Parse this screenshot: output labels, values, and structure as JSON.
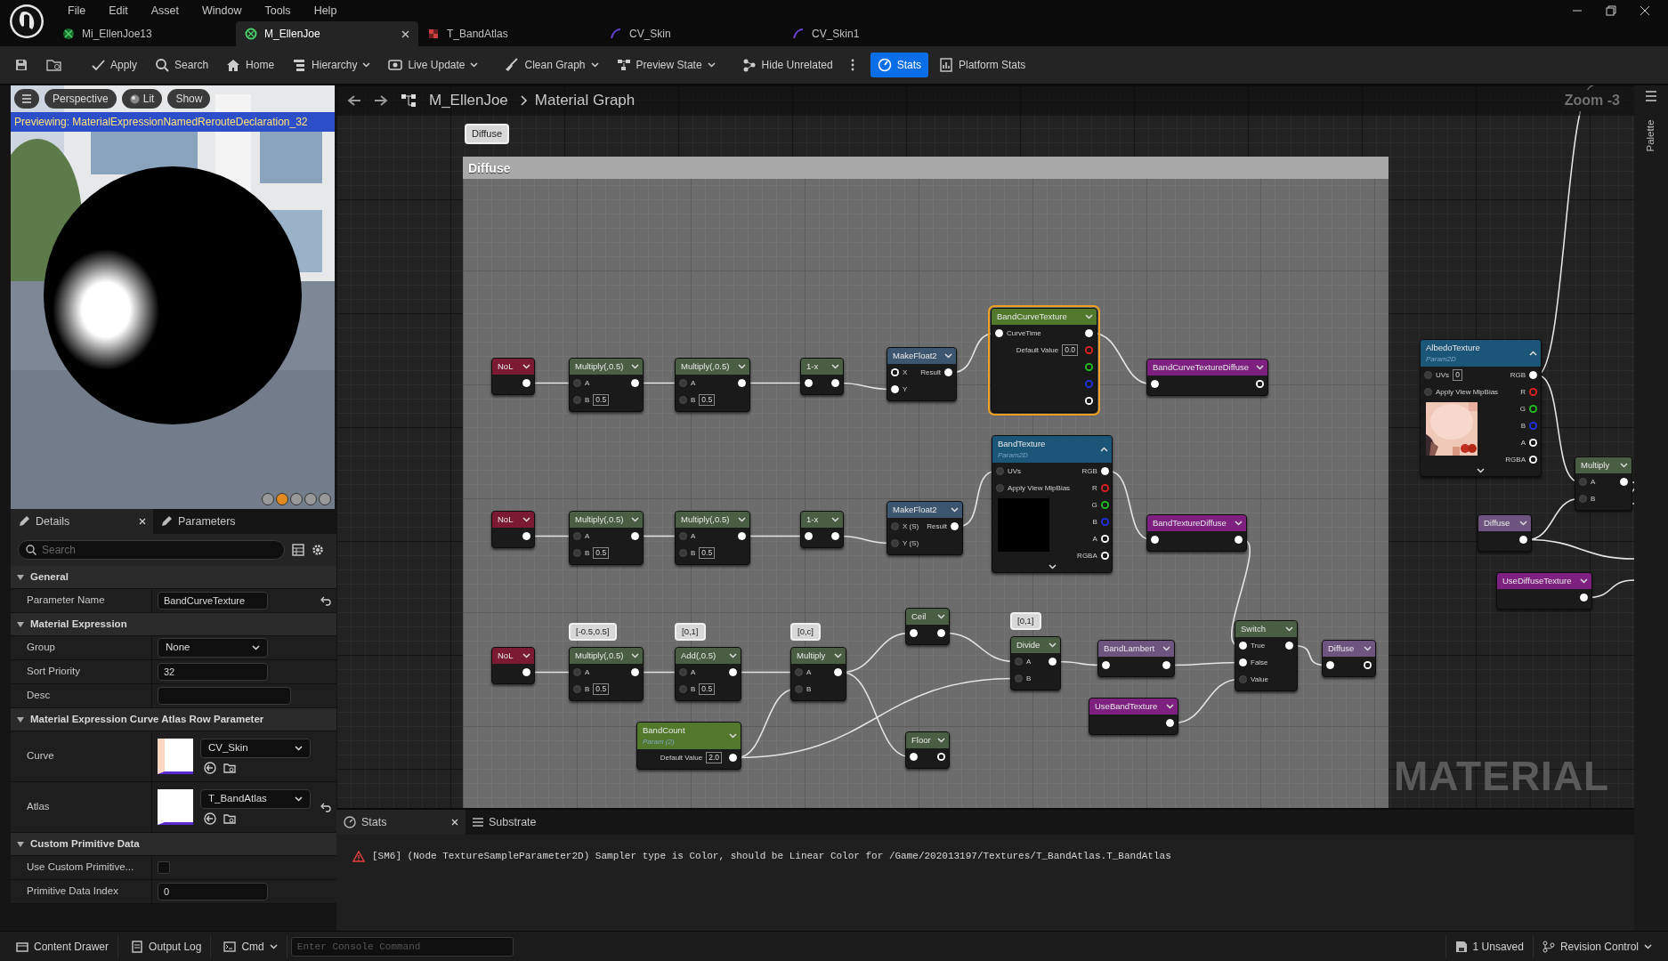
{
  "menu": [
    "File",
    "Edit",
    "Asset",
    "Window",
    "Tools",
    "Help"
  ],
  "tabs": [
    {
      "label": "Mi_EllenJoe13",
      "kind": "instance",
      "selected": false
    },
    {
      "label": "M_EllenJoe",
      "kind": "material",
      "selected": true
    },
    {
      "label": "T_BandAtlas",
      "kind": "texture",
      "selected": false
    },
    {
      "label": "CV_Skin",
      "kind": "curve",
      "selected": false
    },
    {
      "label": "CV_Skin1",
      "kind": "curve",
      "selected": false
    }
  ],
  "toolbar": [
    {
      "label": "Apply",
      "kind": "button",
      "selected": false
    },
    {
      "label": "Search",
      "kind": "button",
      "selected": false
    },
    {
      "label": "Home",
      "kind": "button",
      "selected": false
    },
    {
      "label": "Hierarchy",
      "kind": "dropdown",
      "selected": false
    },
    {
      "label": "Live Update",
      "kind": "dropdown",
      "selected": false
    },
    {
      "label": "Clean Graph",
      "kind": "dropdown",
      "selected": false
    },
    {
      "label": "Preview State",
      "kind": "dropdown",
      "selected": false
    },
    {
      "label": "Hide Unrelated",
      "kind": "button",
      "selected": false
    },
    {
      "kind": "more",
      "selected": false
    },
    {
      "label": "Stats",
      "kind": "button",
      "selected": true
    },
    {
      "label": "Platform Stats",
      "kind": "button",
      "selected": false
    }
  ],
  "viewport": {
    "buttons": [
      "Perspective",
      "Lit",
      "Show"
    ],
    "banner": "Previewing: MaterialExpressionNamedRerouteDeclaration_32"
  },
  "details": {
    "tabs": [
      {
        "label": "Details",
        "selected": true
      },
      {
        "label": "Parameters",
        "selected": false
      }
    ],
    "search": {
      "placeholder": "Search"
    },
    "sections": [
      {
        "title": "General",
        "expanded": true,
        "rows": [
          {
            "label": "Parameter Name",
            "kind": "text",
            "value": "BandCurveTexture",
            "reset": true
          }
        ]
      },
      {
        "title": "Material Expression",
        "expanded": true,
        "rows": [
          {
            "label": "Group",
            "kind": "dropdown",
            "value": "None",
            "reset": false
          },
          {
            "label": "Sort Priority",
            "kind": "text",
            "value": "32",
            "reset": false
          },
          {
            "label": "Desc",
            "kind": "text",
            "reset": false
          }
        ]
      },
      {
        "title": "Material Expression Curve Atlas Row Parameter",
        "expanded": true,
        "rows": [
          {
            "label": "Curve",
            "kind": "asset",
            "value": "CV_Skin",
            "reset": false
          },
          {
            "label": "Atlas",
            "kind": "asset",
            "value": "T_BandAtlas",
            "reset": true
          }
        ]
      },
      {
        "title": "Custom Primitive Data",
        "expanded": true,
        "rows": [
          {
            "label": "Use Custom Primitive...",
            "kind": "checkbox",
            "checked": false,
            "reset": false
          },
          {
            "label": "Primitive Data Index",
            "kind": "text",
            "value": "0",
            "reset": false
          }
        ]
      }
    ]
  },
  "graph": {
    "breadcrumb": [
      "M_EllenJoe",
      "Material Graph"
    ],
    "zoom": "Zoom -3",
    "comment": {
      "bubble": "Diffuse",
      "title": "Diffuse"
    },
    "nodes": [
      {
        "title": "NoL",
        "color": "#7a1a33",
        "selected": false,
        "outputs": [
          {
            "kind": "filled"
          }
        ]
      },
      {
        "title": "Multiply(,0.5)",
        "color": "#4a5e44",
        "selected": false,
        "inputs": [
          {
            "label": "A",
            "kind": "dim"
          },
          {
            "label": "B",
            "kind": "dim",
            "value": "0.5"
          }
        ],
        "outputs": [
          {
            "kind": "filled"
          }
        ]
      },
      {
        "title": "Multiply(,0.5)",
        "color": "#4a5e44",
        "selected": false,
        "inputs": [
          {
            "label": "A",
            "kind": "dim"
          },
          {
            "label": "B",
            "kind": "dim",
            "value": "0.5"
          }
        ],
        "outputs": [
          {
            "kind": "filled"
          }
        ]
      },
      {
        "title": "1-x",
        "color": "#4a5e44",
        "selected": false,
        "inputs": [
          {
            "kind": "filled"
          }
        ],
        "outputs": [
          {
            "kind": "filled"
          }
        ]
      },
      {
        "title": "MakeFloat2",
        "color": "#3d5670",
        "selected": false,
        "inputs": [
          {
            "label": "X",
            "kind": "hollow"
          },
          {
            "label": "Y",
            "kind": "filled"
          }
        ],
        "outputs": [
          {
            "label": "Result",
            "kind": "filled"
          }
        ]
      },
      {
        "title": "BandCurveTexture",
        "color": "#52782c",
        "selected": true,
        "inputs": [
          {
            "label": "CurveTime",
            "kind": "filled"
          }
        ],
        "properties": [
          {
            "label": "Default Value",
            "value": "0.0"
          }
        ],
        "outputs": [
          {
            "kind": "filled",
            "color": "#ffffff"
          },
          {
            "kind": "hollow",
            "color": "#e02020"
          },
          {
            "kind": "hollow",
            "color": "#20c020"
          },
          {
            "kind": "hollow",
            "color": "#2030e0"
          },
          {
            "kind": "hollow",
            "color": "#ffffff"
          }
        ]
      },
      {
        "title": "NoL",
        "color": "#7a1a33",
        "selected": false,
        "outputs": [
          {
            "kind": "filled"
          }
        ]
      },
      {
        "title": "Multiply(,0.5)",
        "color": "#4a5e44",
        "selected": false,
        "inputs": [
          {
            "label": "A",
            "kind": "dim"
          },
          {
            "label": "B",
            "kind": "dim",
            "value": "0.5"
          }
        ],
        "outputs": [
          {
            "kind": "filled"
          }
        ]
      },
      {
        "title": "Multiply(,0.5)",
        "color": "#4a5e44",
        "selected": false,
        "inputs": [
          {
            "label": "A",
            "kind": "dim"
          },
          {
            "label": "B",
            "kind": "dim",
            "value": "0.5"
          }
        ],
        "outputs": [
          {
            "kind": "filled"
          }
        ]
      },
      {
        "title": "1-x",
        "color": "#4a5e44",
        "selected": false,
        "inputs": [
          {
            "kind": "filled"
          }
        ],
        "outputs": [
          {
            "kind": "filled"
          }
        ]
      },
      {
        "title": "MakeFloat2",
        "color": "#3d5670",
        "selected": false,
        "inputs": [
          {
            "label": "X (S)",
            "kind": "dim"
          },
          {
            "label": "Y (S)",
            "kind": "dim"
          }
        ],
        "outputs": [
          {
            "label": "Result",
            "kind": "filled"
          }
        ]
      },
      {
        "title": "BandTexture",
        "subtitle": "Param2D",
        "color": "#1b5577",
        "selected": false,
        "preview": {
          "kind": "blank"
        },
        "inputs": [
          {
            "label": "UVs",
            "kind": "dim"
          },
          {
            "label": "Apply View MipBias",
            "kind": "dim"
          }
        ],
        "outputs": [
          {
            "label": "RGB",
            "kind": "filled",
            "color": "#ffffff"
          },
          {
            "label": "R",
            "kind": "hollow",
            "color": "#e02020"
          },
          {
            "label": "G",
            "kind": "hollow",
            "color": "#20c020"
          },
          {
            "label": "B",
            "kind": "hollow",
            "color": "#2030e0"
          },
          {
            "label": "A",
            "kind": "hollow",
            "color": "#ffffff"
          },
          {
            "label": "RGBA",
            "kind": "hollow",
            "color": "#ffffff"
          }
        ]
      },
      {
        "title": "NoL",
        "color": "#7a1a33",
        "selected": false,
        "outputs": [
          {
            "kind": "filled"
          }
        ]
      },
      {
        "title": "Multiply(,0.5)",
        "bubble": "[-0.5,0.5]",
        "color": "#4a5e44",
        "selected": false,
        "inputs": [
          {
            "label": "A",
            "kind": "dim"
          },
          {
            "label": "B",
            "kind": "dim",
            "value": "0.5"
          }
        ],
        "outputs": [
          {
            "kind": "filled"
          }
        ]
      },
      {
        "title": "Add(,0.5)",
        "bubble": "[0,1]",
        "color": "#4a5e44",
        "selected": false,
        "inputs": [
          {
            "label": "A",
            "kind": "dim"
          },
          {
            "label": "B",
            "kind": "dim",
            "value": "0.5"
          }
        ],
        "outputs": [
          {
            "kind": "filled"
          }
        ]
      },
      {
        "title": "Multiply",
        "bubble": "[0,c]",
        "color": "#4a5e44",
        "selected": false,
        "inputs": [
          {
            "label": "A",
            "kind": "dim"
          },
          {
            "label": "B",
            "kind": "dim"
          }
        ],
        "outputs": [
          {
            "kind": "filled"
          }
        ]
      },
      {
        "title": "Ceil",
        "color": "#4a5e44",
        "selected": false,
        "inputs": [
          {
            "kind": "filled"
          }
        ],
        "outputs": [
          {
            "kind": "filled"
          }
        ]
      },
      {
        "title": "Floor",
        "color": "#4a5e44",
        "selected": false,
        "inputs": [
          {
            "kind": "filled"
          }
        ],
        "outputs": [
          {
            "kind": "hollow"
          }
        ]
      },
      {
        "title": "Divide",
        "bubble": "[0,1]",
        "color": "#4a5e44",
        "selected": false,
        "inputs": [
          {
            "label": "A",
            "kind": "dim"
          },
          {
            "label": "B",
            "kind": "dim"
          }
        ],
        "outputs": [
          {
            "kind": "filled"
          }
        ]
      },
      {
        "title": "BandCount",
        "subtitle": "Param (2)",
        "color": "#52782c",
        "selected": false,
        "properties": [
          {
            "label": "Default Value",
            "value": "2.0"
          }
        ],
        "outputs": [
          {
            "kind": "filled"
          }
        ]
      },
      {
        "title": "BandCurveTextureDiffuse",
        "color": "#7d2080",
        "selected": false,
        "inputs": [
          {
            "kind": "filled"
          }
        ],
        "outputs": [
          {
            "kind": "hollow"
          }
        ]
      },
      {
        "title": "BandTextureDiffuse",
        "color": "#7d2080",
        "selected": false,
        "inputs": [
          {
            "kind": "filled"
          }
        ],
        "outputs": [
          {
            "kind": "filled"
          }
        ]
      },
      {
        "title": "BandLambert",
        "color": "#6e5580",
        "selected": false,
        "inputs": [
          {
            "kind": "filled"
          }
        ],
        "outputs": [
          {
            "kind": "filled"
          }
        ]
      },
      {
        "title": "UseBandTexture",
        "color": "#7d2080",
        "selected": false,
        "outputs": [
          {
            "kind": "filled"
          }
        ]
      },
      {
        "title": "Switch",
        "color": "#4a5e44",
        "selected": false,
        "inputs": [
          {
            "label": "True",
            "kind": "filled"
          },
          {
            "label": "False",
            "kind": "filled"
          },
          {
            "label": "Value",
            "kind": "dim"
          }
        ],
        "outputs": [
          {
            "kind": "filled"
          }
        ]
      },
      {
        "title": "Diffuse",
        "color": "#6e5580",
        "selected": false,
        "inputs": [
          {
            "kind": "filled"
          }
        ],
        "outputs": [
          {
            "kind": "hollow"
          }
        ]
      },
      {
        "title": "AlbedoTexture",
        "subtitle": "Param2D",
        "color": "#1b5577",
        "selected": false,
        "preview": {
          "kind": "picture"
        },
        "inputs": [
          {
            "label": "UVs",
            "kind": "dim",
            "value": "0"
          },
          {
            "label": "Apply View MipBias",
            "kind": "dim"
          }
        ],
        "outputs": [
          {
            "label": "RGB",
            "kind": "filled",
            "color": "#ffffff"
          },
          {
            "label": "R",
            "kind": "hollow",
            "color": "#e02020"
          },
          {
            "label": "G",
            "kind": "hollow",
            "color": "#20c020"
          },
          {
            "label": "B",
            "kind": "hollow",
            "color": "#2030e0"
          },
          {
            "label": "A",
            "kind": "hollow",
            "color": "#ffffff"
          },
          {
            "label": "RGBA",
            "kind": "hollow",
            "color": "#ffffff"
          }
        ]
      },
      {
        "title": "Multiply",
        "color": "#4a5e44",
        "selected": false,
        "inputs": [
          {
            "label": "A",
            "kind": "dim"
          },
          {
            "label": "B",
            "kind": "dim"
          }
        ],
        "outputs": [
          {
            "kind": "filled"
          }
        ]
      },
      {
        "title": "Diffuse",
        "color": "#6e5580",
        "selected": false,
        "outputs": [
          {
            "kind": "filled"
          }
        ]
      },
      {
        "title": "UseDiffuseTexture",
        "color": "#7d2080",
        "selected": false,
        "outputs": [
          {
            "kind": "filled"
          }
        ]
      }
    ],
    "corner_label": "MATERIAL"
  },
  "palette": {
    "label": "Palette"
  },
  "stats": {
    "tabs": [
      {
        "label": "Stats",
        "selected": true
      },
      {
        "label": "Substrate",
        "selected": false
      }
    ],
    "messages": [
      {
        "kind": "warning",
        "text": "[SM6] (Node TextureSampleParameter2D) Sampler type is Color, should be Linear Color for /Game/202013197/Textures/T_BandAtlas.T_BandAtlas"
      }
    ]
  },
  "status_bar": {
    "left": [
      {
        "label": "Content Drawer",
        "kind": "button"
      },
      {
        "label": "Output Log",
        "kind": "button"
      },
      {
        "label": "Cmd",
        "kind": "dropdown"
      }
    ],
    "console": {
      "placeholder": "Enter Console Command"
    },
    "right": [
      {
        "label": "1 Unsaved",
        "kind": "button"
      },
      {
        "label": "Revision Control",
        "kind": "dropdown"
      }
    ]
  }
}
